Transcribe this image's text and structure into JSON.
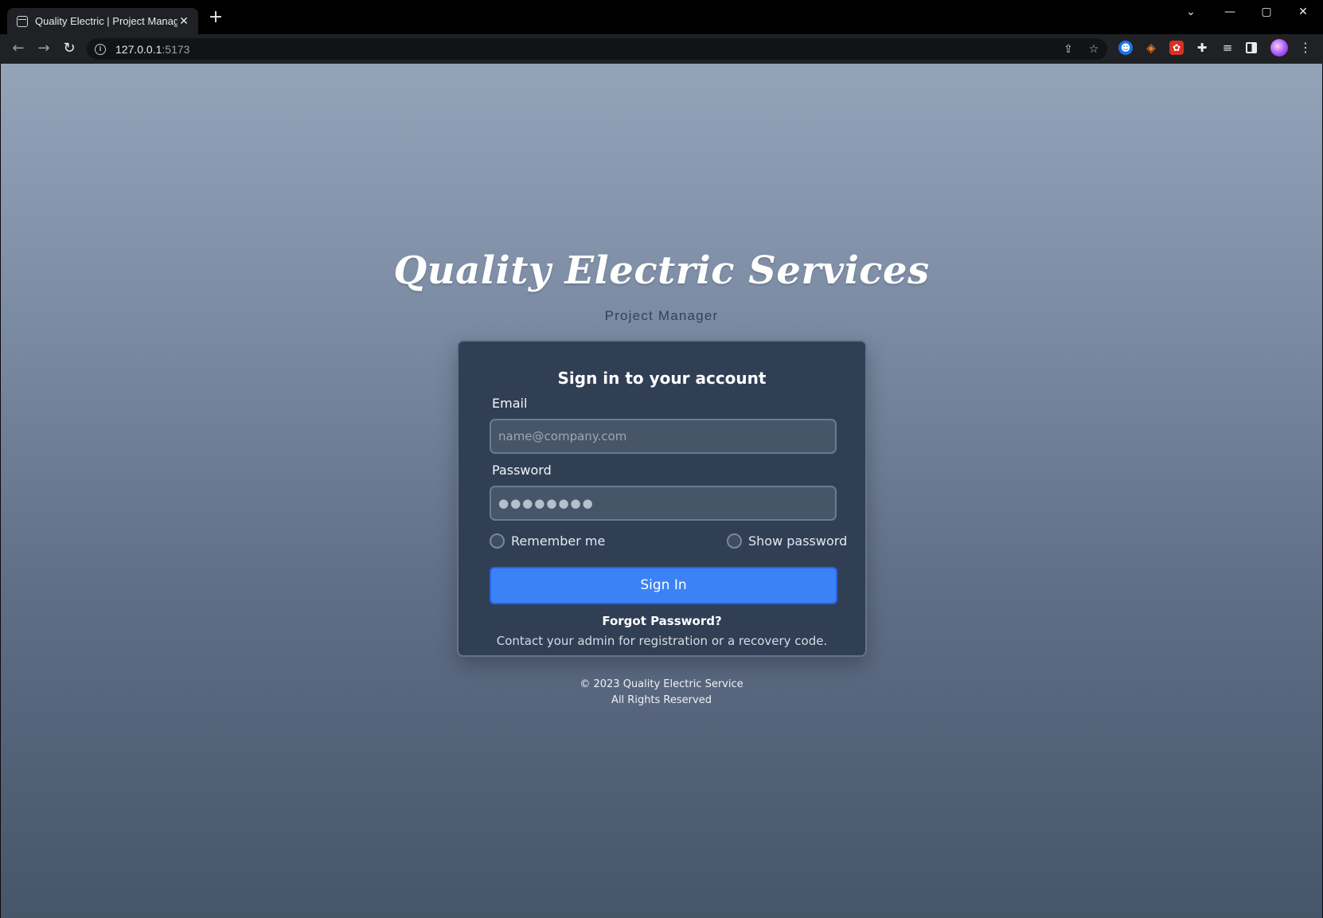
{
  "browser": {
    "tab_title": "Quality Electric | Project Manager",
    "tab_close": "✕",
    "new_tab": "+",
    "url_host": "127.0.0.1",
    "url_port": ":5173",
    "window_controls": {
      "chevron": "⌄",
      "minimize": "—",
      "maximize": "▢",
      "close": "✕"
    },
    "nav": {
      "back": "←",
      "forward": "→",
      "reload": "↻"
    },
    "toolbar_icons": [
      "share-icon",
      "star-icon",
      "extension-ghost-icon",
      "extension-diamond-icon",
      "extension-red-icon",
      "puzzle-icon",
      "reading-list-icon",
      "side-panel-icon",
      "profile-avatar",
      "more-menu-icon"
    ]
  },
  "page": {
    "brand_title": "Quality Electric Services",
    "subtitle": "Project Manager",
    "card": {
      "heading": "Sign in to your account",
      "email_label": "Email",
      "email_placeholder": "name@company.com",
      "password_label": "Password",
      "password_value": "●●●●●●●●",
      "remember_label": "Remember me",
      "show_password_label": "Show password",
      "signin_label": "Sign In",
      "forgot_label": "Forgot Password?",
      "contact_text": "Contact your admin for registration or a recovery code."
    },
    "footer": {
      "copyright": "© 2023 Quality Electric Service",
      "rights": "All Rights Reserved"
    }
  },
  "colors": {
    "accent": "#3b82f6",
    "card_bg": "#313f55",
    "bg_top": "#94a3b8",
    "bg_bottom": "#475569"
  }
}
